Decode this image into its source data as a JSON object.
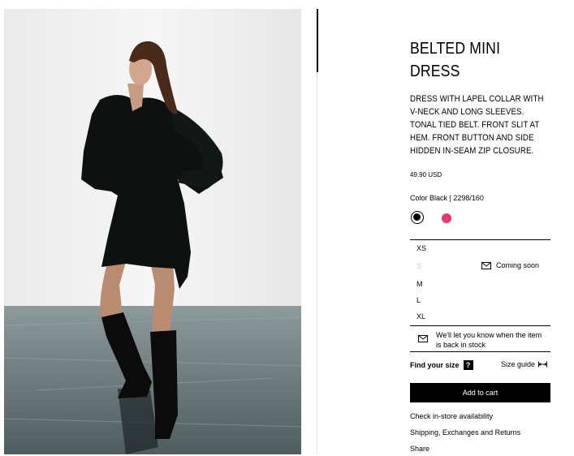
{
  "product": {
    "title": "BELTED MINI DRESS",
    "description": "DRESS WITH LAPEL COLLAR WITH V-NECK AND LONG SLEEVES. TONAL TIED BELT. FRONT SLIT AT HEM. FRONT BUTTON AND SIDE HIDDEN IN-SEAM ZIP CLOSURE.",
    "price": "49.90 USD",
    "color_line": "Color Black | 2298/160"
  },
  "swatches": [
    {
      "name": "Black",
      "color": "#000000",
      "selected": true
    },
    {
      "name": "Pink",
      "color": "#e8376a",
      "selected": false
    }
  ],
  "sizes": {
    "items": [
      {
        "label": "XS",
        "available": true
      },
      {
        "label": "S",
        "available": false
      },
      {
        "label": "M",
        "available": true
      },
      {
        "label": "L",
        "available": true
      },
      {
        "label": "XL",
        "available": true
      }
    ],
    "coming_soon": "Coming soon"
  },
  "notify_text": "We'll let you know when the item is back in stock",
  "find_size": {
    "label": "Find your size",
    "help": "?"
  },
  "size_guide": "Size guide",
  "cart_button": "Add to cart",
  "links": {
    "store": "Check in-store availability",
    "shipping": "Shipping, Exchanges and Returns",
    "share": "Share"
  },
  "icons": [
    "mail-icon",
    "ruler-icon",
    "help-icon"
  ]
}
